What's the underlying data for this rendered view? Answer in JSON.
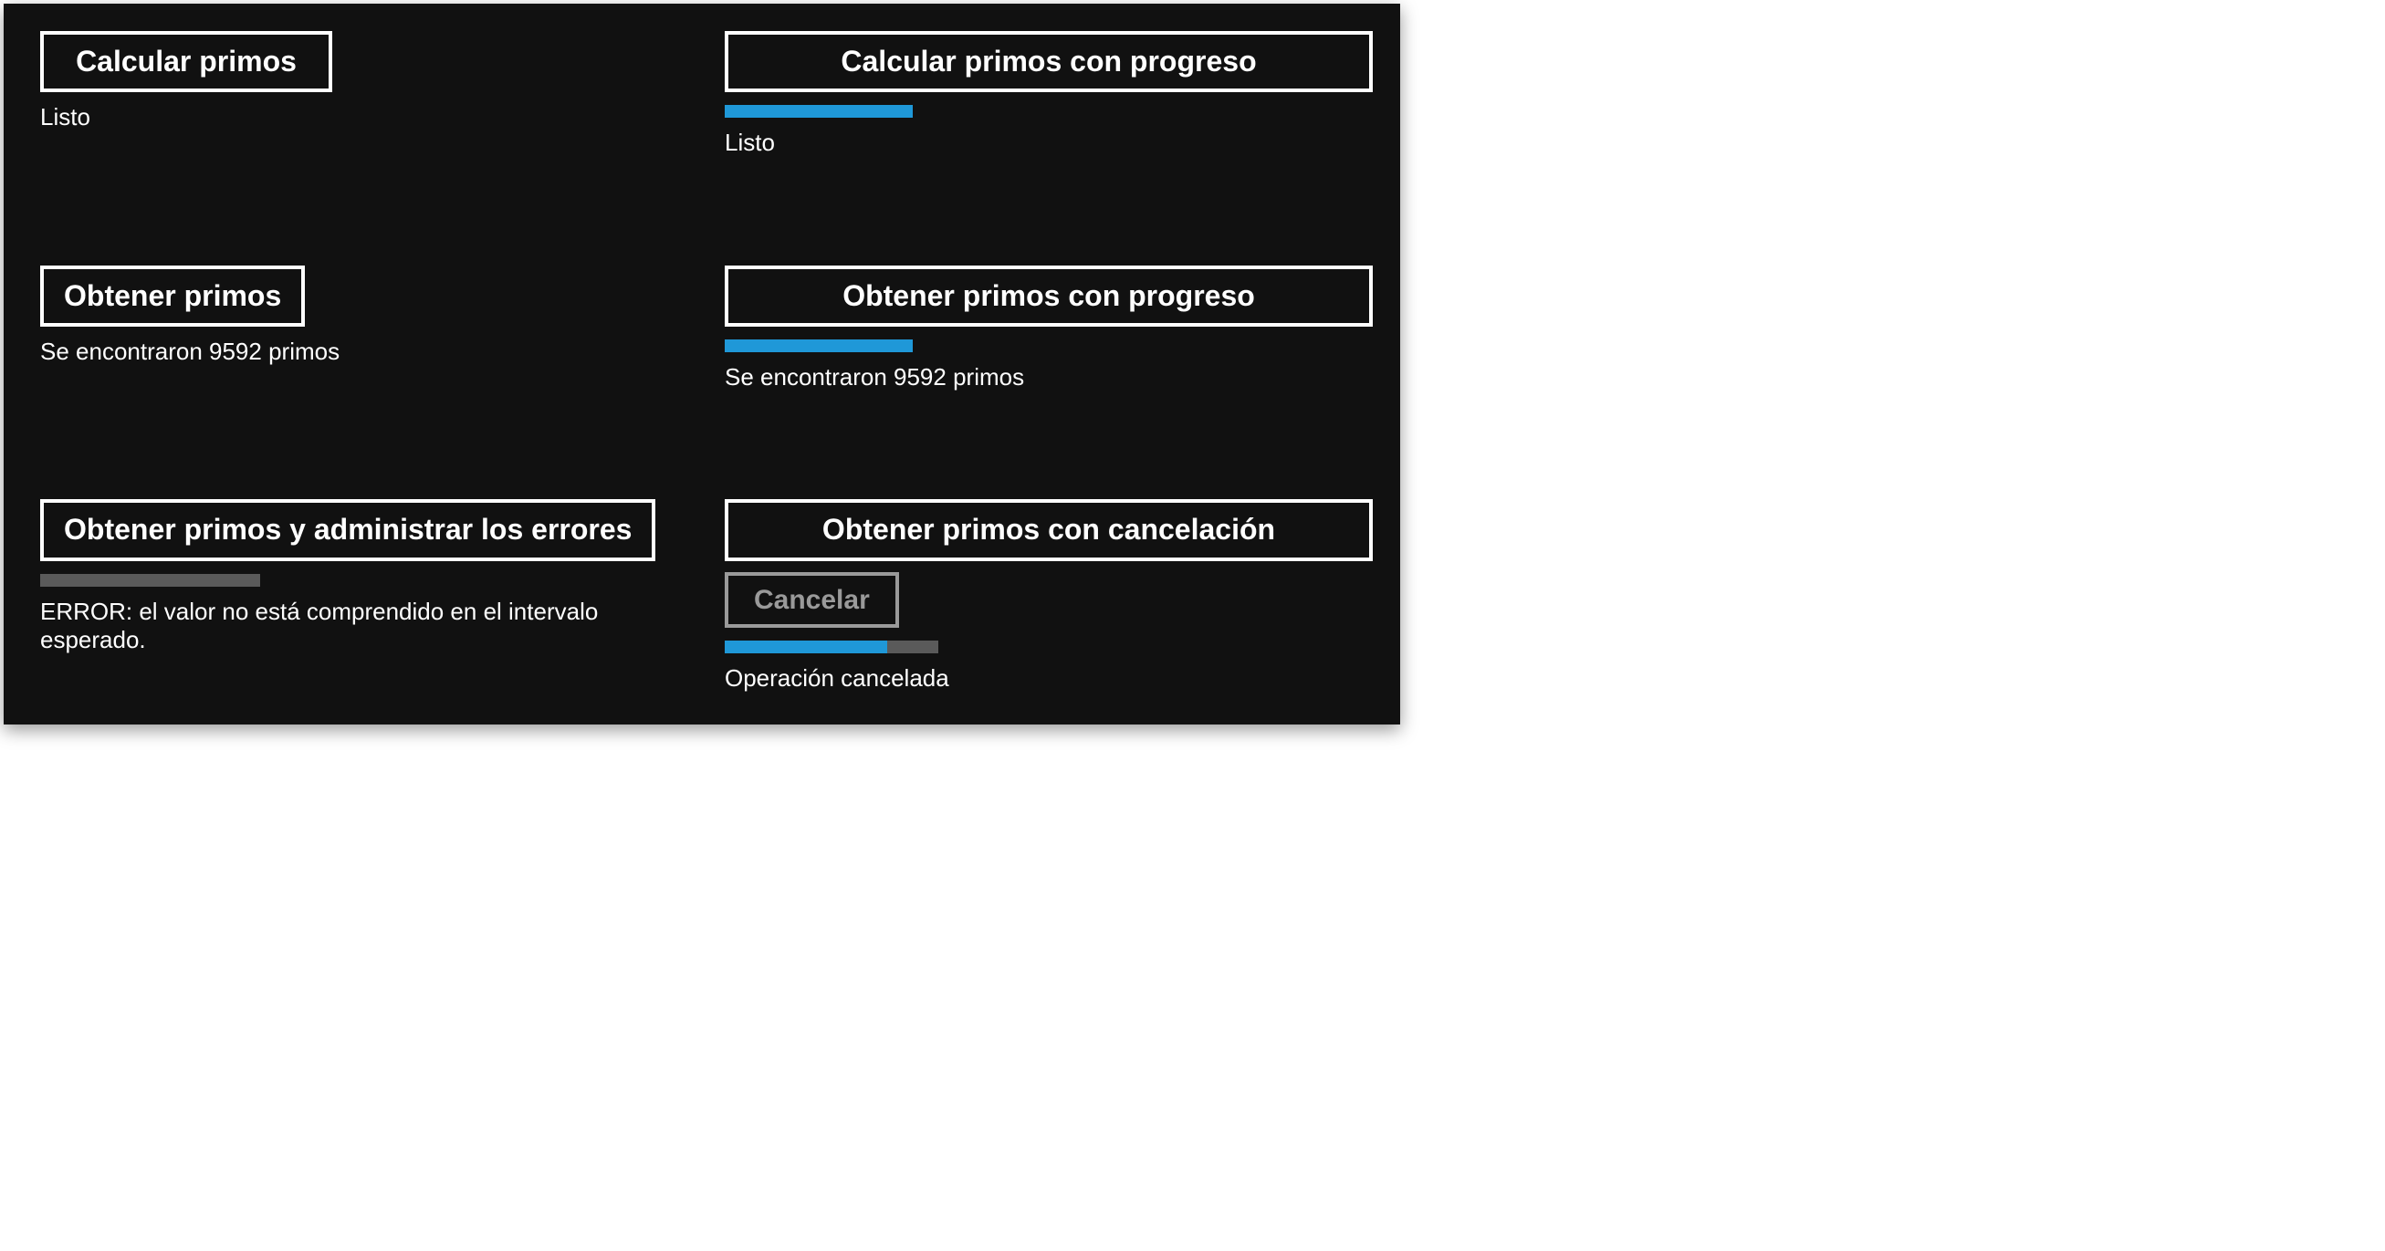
{
  "colors": {
    "accent": "#1f98d8",
    "muted": "#5a5a5a",
    "disabled": "#9a9a9a"
  },
  "cells": {
    "calc": {
      "button": "Calcular primos",
      "status": "Listo"
    },
    "calc_progress": {
      "button": "Calcular primos con progreso",
      "progress": {
        "fill_pct": 29,
        "track_pct": 0
      },
      "status": "Listo"
    },
    "get": {
      "button": "Obtener primos",
      "status": "Se encontraron 9592 primos"
    },
    "get_progress": {
      "button": "Obtener primos con progreso",
      "progress": {
        "fill_pct": 29,
        "track_pct": 0
      },
      "status": "Se encontraron 9592 primos"
    },
    "get_errors": {
      "button": "Obtener primos y administrar los errores",
      "progress": {
        "fill_pct": 0,
        "track_pct": 34
      },
      "status": "ERROR: el valor no está comprendido en el intervalo esperado."
    },
    "get_cancel": {
      "button": "Obtener primos con cancelación",
      "cancel_button": "Cancelar",
      "progress": {
        "fill_pct": 25,
        "track_pct": 33
      },
      "status": "Operación cancelada"
    }
  }
}
